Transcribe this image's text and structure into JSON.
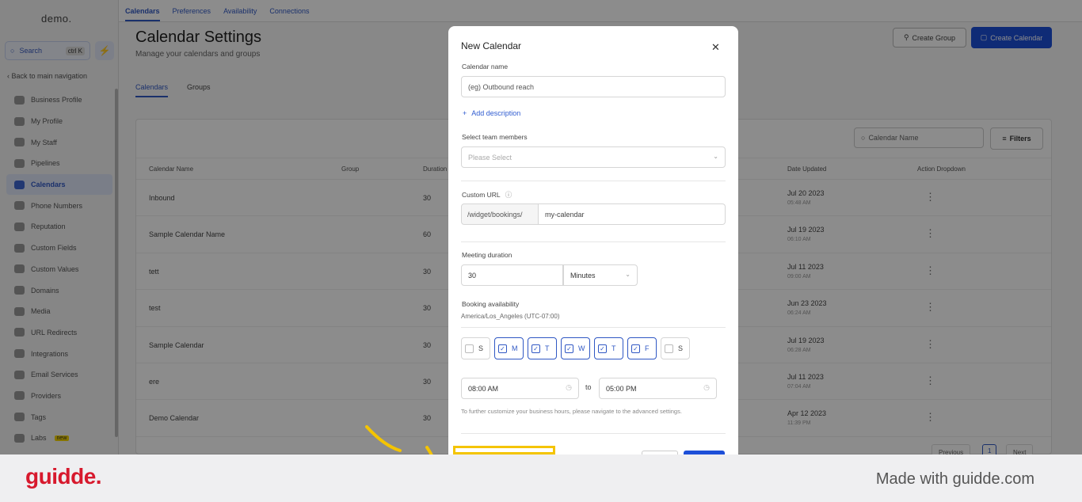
{
  "sidebar": {
    "logo": "demo.",
    "search_label": "Search",
    "search_shortcut": "ctrl K",
    "back_label": "Back to main navigation",
    "items": [
      {
        "label": "Business Profile",
        "icon": "briefcase-icon"
      },
      {
        "label": "My Profile",
        "icon": "user-circle-icon"
      },
      {
        "label": "My Staff",
        "icon": "users-icon"
      },
      {
        "label": "Pipelines",
        "icon": "funnel-icon"
      },
      {
        "label": "Calendars",
        "icon": "calendar-icon",
        "active": true
      },
      {
        "label": "Phone Numbers",
        "icon": "phone-icon"
      },
      {
        "label": "Reputation",
        "icon": "star-icon"
      },
      {
        "label": "Custom Fields",
        "icon": "fields-icon"
      },
      {
        "label": "Custom Values",
        "icon": "diamond-icon"
      },
      {
        "label": "Domains",
        "icon": "globe-icon"
      },
      {
        "label": "Media",
        "icon": "image-icon"
      },
      {
        "label": "URL Redirects",
        "icon": "link-icon"
      },
      {
        "label": "Integrations",
        "icon": "plug-icon"
      },
      {
        "label": "Email Services",
        "icon": "mail-icon"
      },
      {
        "label": "Providers",
        "icon": "server-icon"
      },
      {
        "label": "Tags",
        "icon": "tag-icon"
      },
      {
        "label": "Labs",
        "icon": "flask-icon",
        "badge": "new"
      }
    ]
  },
  "topnav": {
    "tabs": [
      "Calendars",
      "Preferences",
      "Availability",
      "Connections"
    ]
  },
  "page": {
    "title": "Calendar Settings",
    "subtitle": "Manage your calendars and groups",
    "create_group": "Create Group",
    "create_calendar": "Create Calendar",
    "subtabs": [
      "Calendars",
      "Groups"
    ],
    "search_placeholder": "Calendar Name",
    "filters": "Filters"
  },
  "table": {
    "headers": [
      "Calendar Name",
      "Group",
      "Duration",
      "Date Updated",
      "Action Dropdown"
    ],
    "rows": [
      {
        "name": "Inbound",
        "duration": "30",
        "date": "Jul 20 2023",
        "time": "05:48 AM"
      },
      {
        "name": "Sample Calendar Name",
        "duration": "60",
        "date": "Jul 19 2023",
        "time": "06:10 AM"
      },
      {
        "name": "tett",
        "duration": "30",
        "date": "Jul 11 2023",
        "time": "09:00 AM"
      },
      {
        "name": "test",
        "duration": "30",
        "date": "Jun 23 2023",
        "time": "06:24 AM"
      },
      {
        "name": "Sample Calendar",
        "duration": "30",
        "date": "Jul 19 2023",
        "time": "06:28 AM"
      },
      {
        "name": "ere",
        "duration": "30",
        "date": "Jul 11 2023",
        "time": "07:04 AM"
      },
      {
        "name": "Demo Calendar",
        "duration": "30",
        "date": "Apr 12 2023",
        "time": "11:39 PM"
      }
    ],
    "pager": {
      "previous": "Previous",
      "page": "1",
      "next": "Next"
    }
  },
  "modal": {
    "title": "New Calendar",
    "name_label": "Calendar name",
    "name_placeholder": "(eg) Outbound reach",
    "add_description": "Add description",
    "team_label": "Select team members",
    "team_placeholder": "Please Select",
    "url_label": "Custom URL",
    "url_prefix": "/widget/bookings/",
    "url_value": "my-calendar",
    "duration_label": "Meeting duration",
    "duration_value": "30",
    "duration_unit": "Minutes",
    "availability_label": "Booking availability",
    "timezone": "America/Los_Angeles (UTC-07:00)",
    "days": [
      {
        "label": "S",
        "checked": false
      },
      {
        "label": "M",
        "checked": true
      },
      {
        "label": "T",
        "checked": true
      },
      {
        "label": "W",
        "checked": true
      },
      {
        "label": "T",
        "checked": true
      },
      {
        "label": "F",
        "checked": true
      },
      {
        "label": "S",
        "checked": false
      }
    ],
    "start_time": "08:00 AM",
    "to_label": "to",
    "end_time": "05:00 PM",
    "hint": "To further customize your business hours, please navigate to the advanced settings."
  },
  "footer": {
    "brand": "guidde.",
    "made_with": "Made with guidde.com"
  },
  "colors": {
    "accent": "#1d4fd8",
    "brand": "#d7192d",
    "highlight": "#f4c400"
  }
}
